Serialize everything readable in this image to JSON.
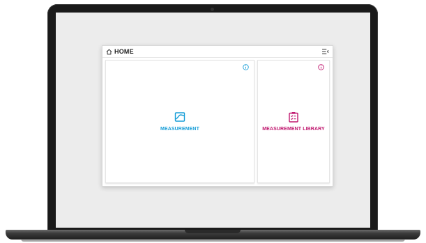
{
  "colors": {
    "measurement_accent": "#1a9fd8",
    "library_accent": "#c0186f",
    "screen_bg": "#ececec"
  },
  "header": {
    "title": "HOME",
    "home_icon": "home-icon",
    "menu_icon": "collapse-menu-icon"
  },
  "cards": [
    {
      "label": "MEASUREMENT",
      "icon": "chart-area-icon",
      "info_icon": "info-icon"
    },
    {
      "label": "MEASUREMENT LIBRARY",
      "icon": "clipboard-list-icon",
      "info_icon": "info-icon"
    }
  ]
}
